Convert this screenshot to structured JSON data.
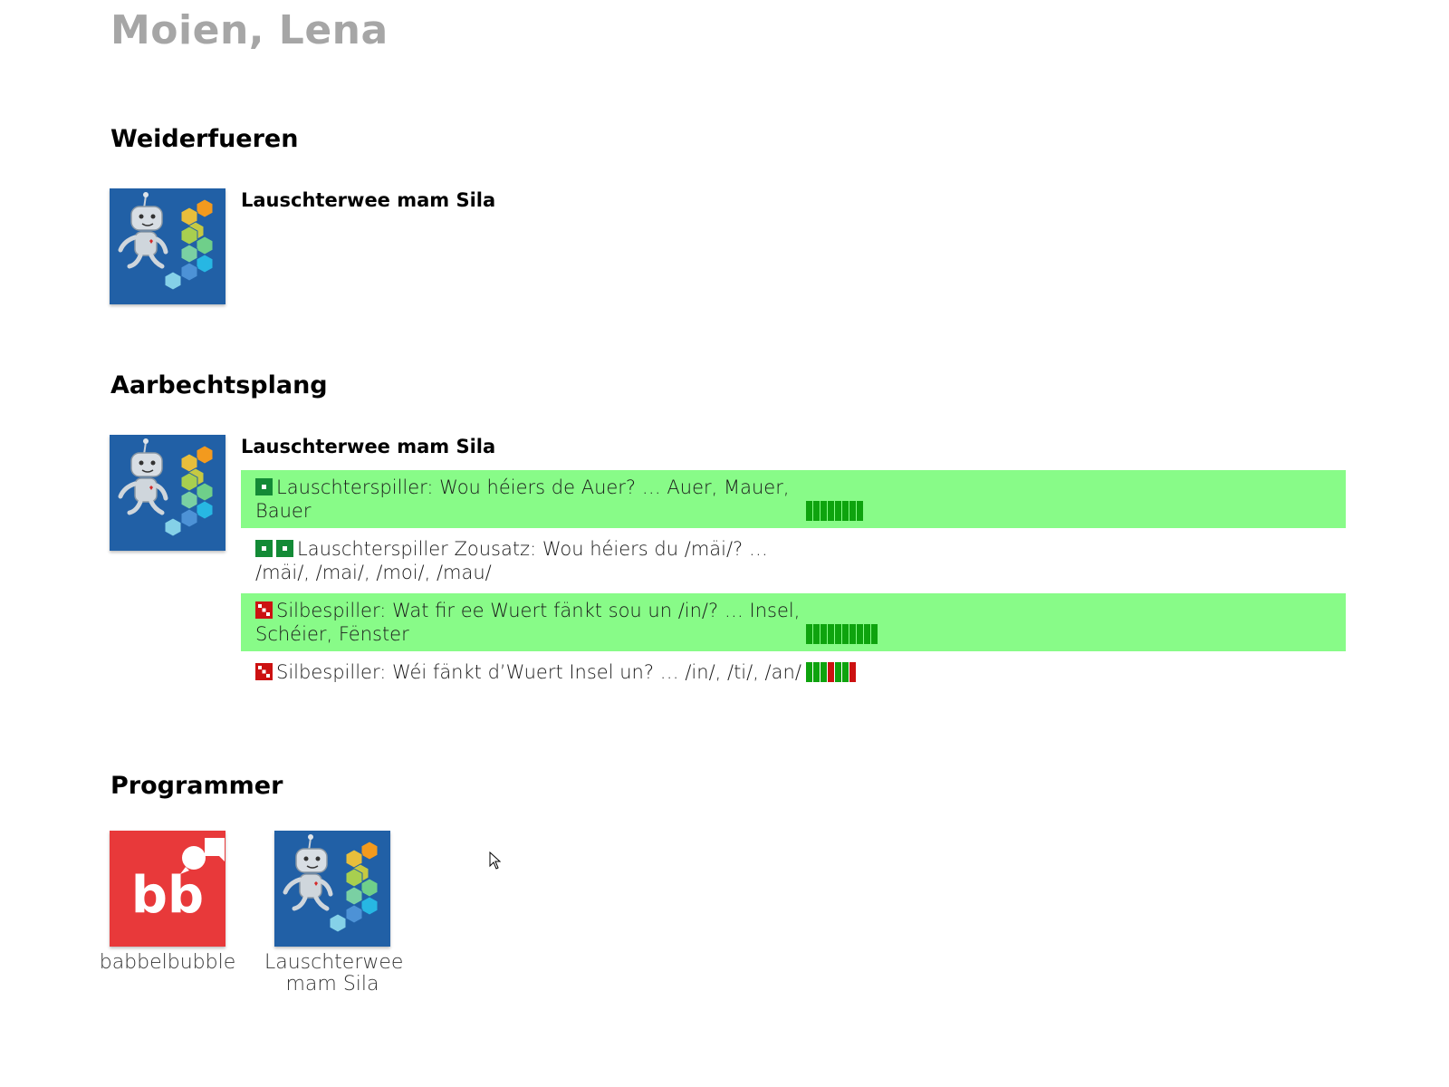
{
  "greeting": "Moien, Lena",
  "continue_section": {
    "title": "Weiderfueren",
    "item": {
      "title": "Lauschterwee mam Sila",
      "icon": "robot-hexagon-app-icon"
    }
  },
  "workplan_section": {
    "title": "Aarbechtsplang",
    "item": {
      "title": "Lauschterwee mam Sila",
      "icon": "robot-hexagon-app-icon"
    },
    "tasks": [
      {
        "level_icon": "green-dice-one-icon",
        "level_dice": [
          "green-1"
        ],
        "text": "Lauschterspiller: Wou héiers de Auer? … Auer, Mauer, Bauer",
        "highlighted": true,
        "progress": [
          "g",
          "g",
          "g",
          "g",
          "g",
          "g",
          "g",
          "g"
        ]
      },
      {
        "level_icon": "green-dice-one-icon",
        "level_dice": [
          "green-1",
          "green-1"
        ],
        "text": "Lauschterspiller Zousatz: Wou héiers du /mäi/? … /mäi/, /mai/, /moi/, /mau/",
        "highlighted": false,
        "progress": []
      },
      {
        "level_icon": "red-dice-three-icon",
        "level_dice": [
          "red-3"
        ],
        "text": "Silbespiller: Wat fir ee Wuert fänkt sou un /in/? … Insel, Schéier, Fënster",
        "highlighted": true,
        "progress": [
          "g",
          "g",
          "g",
          "g",
          "g",
          "g",
          "g",
          "g",
          "g",
          "g"
        ]
      },
      {
        "level_icon": "red-dice-three-icon",
        "level_dice": [
          "red-3"
        ],
        "text": "Silbespiller: Wéi fänkt d’Wuert Insel un? … /in/, /ti/, /an/",
        "highlighted": false,
        "progress": [
          "g",
          "g",
          "g",
          "r",
          "g",
          "g",
          "r"
        ]
      }
    ]
  },
  "programs_section": {
    "title": "Programmer",
    "items": [
      {
        "label": "babbelbubble",
        "logo_text": "bb",
        "icon": "babbelbubble-app-icon"
      },
      {
        "label": "Lauschterwee mam Sila",
        "icon": "robot-hexagon-app-icon"
      }
    ]
  },
  "colors": {
    "highlight": "#88fb88",
    "progress_good": "#0ea30e",
    "progress_bad": "#cc1111",
    "level_green": "#138a36",
    "level_red": "#cc1111",
    "app_blue": "#2160a6",
    "app_red": "#e8393a",
    "greeting_gray": "#a6a6a6"
  }
}
